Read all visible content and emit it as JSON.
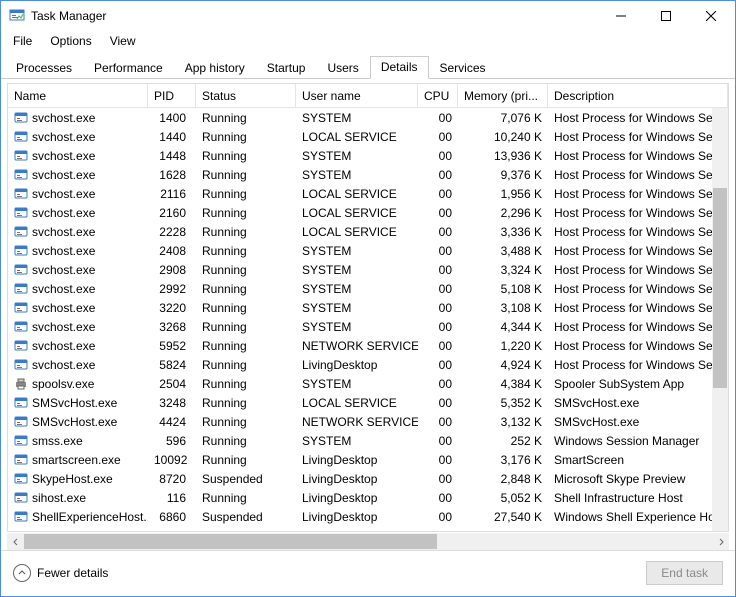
{
  "window": {
    "title": "Task Manager"
  },
  "menu": {
    "file": "File",
    "options": "Options",
    "view": "View"
  },
  "tabs": {
    "processes": "Processes",
    "performance": "Performance",
    "apphistory": "App history",
    "startup": "Startup",
    "users": "Users",
    "details": "Details",
    "services": "Services"
  },
  "columns": {
    "name": "Name",
    "pid": "PID",
    "status": "Status",
    "user": "User name",
    "cpu": "CPU",
    "mem": "Memory (pri...",
    "desc": "Description"
  },
  "rows": [
    {
      "icon": "app",
      "name": "svchost.exe",
      "pid": "1400",
      "status": "Running",
      "user": "SYSTEM",
      "cpu": "00",
      "mem": "7,076 K",
      "desc": "Host Process for Windows Serv"
    },
    {
      "icon": "app",
      "name": "svchost.exe",
      "pid": "1440",
      "status": "Running",
      "user": "LOCAL SERVICE",
      "cpu": "00",
      "mem": "10,240 K",
      "desc": "Host Process for Windows Serv"
    },
    {
      "icon": "app",
      "name": "svchost.exe",
      "pid": "1448",
      "status": "Running",
      "user": "SYSTEM",
      "cpu": "00",
      "mem": "13,936 K",
      "desc": "Host Process for Windows Serv"
    },
    {
      "icon": "app",
      "name": "svchost.exe",
      "pid": "1628",
      "status": "Running",
      "user": "SYSTEM",
      "cpu": "00",
      "mem": "9,376 K",
      "desc": "Host Process for Windows Serv"
    },
    {
      "icon": "app",
      "name": "svchost.exe",
      "pid": "2116",
      "status": "Running",
      "user": "LOCAL SERVICE",
      "cpu": "00",
      "mem": "1,956 K",
      "desc": "Host Process for Windows Serv"
    },
    {
      "icon": "app",
      "name": "svchost.exe",
      "pid": "2160",
      "status": "Running",
      "user": "LOCAL SERVICE",
      "cpu": "00",
      "mem": "2,296 K",
      "desc": "Host Process for Windows Serv"
    },
    {
      "icon": "app",
      "name": "svchost.exe",
      "pid": "2228",
      "status": "Running",
      "user": "LOCAL SERVICE",
      "cpu": "00",
      "mem": "3,336 K",
      "desc": "Host Process for Windows Serv"
    },
    {
      "icon": "app",
      "name": "svchost.exe",
      "pid": "2408",
      "status": "Running",
      "user": "SYSTEM",
      "cpu": "00",
      "mem": "3,488 K",
      "desc": "Host Process for Windows Serv"
    },
    {
      "icon": "app",
      "name": "svchost.exe",
      "pid": "2908",
      "status": "Running",
      "user": "SYSTEM",
      "cpu": "00",
      "mem": "3,324 K",
      "desc": "Host Process for Windows Serv"
    },
    {
      "icon": "app",
      "name": "svchost.exe",
      "pid": "2992",
      "status": "Running",
      "user": "SYSTEM",
      "cpu": "00",
      "mem": "5,108 K",
      "desc": "Host Process for Windows Serv"
    },
    {
      "icon": "app",
      "name": "svchost.exe",
      "pid": "3220",
      "status": "Running",
      "user": "SYSTEM",
      "cpu": "00",
      "mem": "3,108 K",
      "desc": "Host Process for Windows Serv"
    },
    {
      "icon": "app",
      "name": "svchost.exe",
      "pid": "3268",
      "status": "Running",
      "user": "SYSTEM",
      "cpu": "00",
      "mem": "4,344 K",
      "desc": "Host Process for Windows Serv"
    },
    {
      "icon": "app",
      "name": "svchost.exe",
      "pid": "5952",
      "status": "Running",
      "user": "NETWORK SERVICE",
      "cpu": "00",
      "mem": "1,220 K",
      "desc": "Host Process for Windows Serv"
    },
    {
      "icon": "app",
      "name": "svchost.exe",
      "pid": "5824",
      "status": "Running",
      "user": "LivingDesktop",
      "cpu": "00",
      "mem": "4,924 K",
      "desc": "Host Process for Windows Serv"
    },
    {
      "icon": "printer",
      "name": "spoolsv.exe",
      "pid": "2504",
      "status": "Running",
      "user": "SYSTEM",
      "cpu": "00",
      "mem": "4,384 K",
      "desc": "Spooler SubSystem App"
    },
    {
      "icon": "app",
      "name": "SMSvcHost.exe",
      "pid": "3248",
      "status": "Running",
      "user": "LOCAL SERVICE",
      "cpu": "00",
      "mem": "5,352 K",
      "desc": "SMSvcHost.exe"
    },
    {
      "icon": "app",
      "name": "SMSvcHost.exe",
      "pid": "4424",
      "status": "Running",
      "user": "NETWORK SERVICE",
      "cpu": "00",
      "mem": "3,132 K",
      "desc": "SMSvcHost.exe"
    },
    {
      "icon": "app",
      "name": "smss.exe",
      "pid": "596",
      "status": "Running",
      "user": "SYSTEM",
      "cpu": "00",
      "mem": "252 K",
      "desc": "Windows Session Manager"
    },
    {
      "icon": "app",
      "name": "smartscreen.exe",
      "pid": "10092",
      "status": "Running",
      "user": "LivingDesktop",
      "cpu": "00",
      "mem": "3,176 K",
      "desc": "SmartScreen"
    },
    {
      "icon": "app",
      "name": "SkypeHost.exe",
      "pid": "8720",
      "status": "Suspended",
      "user": "LivingDesktop",
      "cpu": "00",
      "mem": "2,848 K",
      "desc": "Microsoft Skype Preview"
    },
    {
      "icon": "app",
      "name": "sihost.exe",
      "pid": "116",
      "status": "Running",
      "user": "LivingDesktop",
      "cpu": "00",
      "mem": "5,052 K",
      "desc": "Shell Infrastructure Host"
    },
    {
      "icon": "app",
      "name": "ShellExperienceHost....",
      "pid": "6860",
      "status": "Suspended",
      "user": "LivingDesktop",
      "cpu": "00",
      "mem": "27,540 K",
      "desc": "Windows Shell Experience Hos"
    }
  ],
  "footer": {
    "fewer": "Fewer details",
    "endtask": "End task"
  }
}
